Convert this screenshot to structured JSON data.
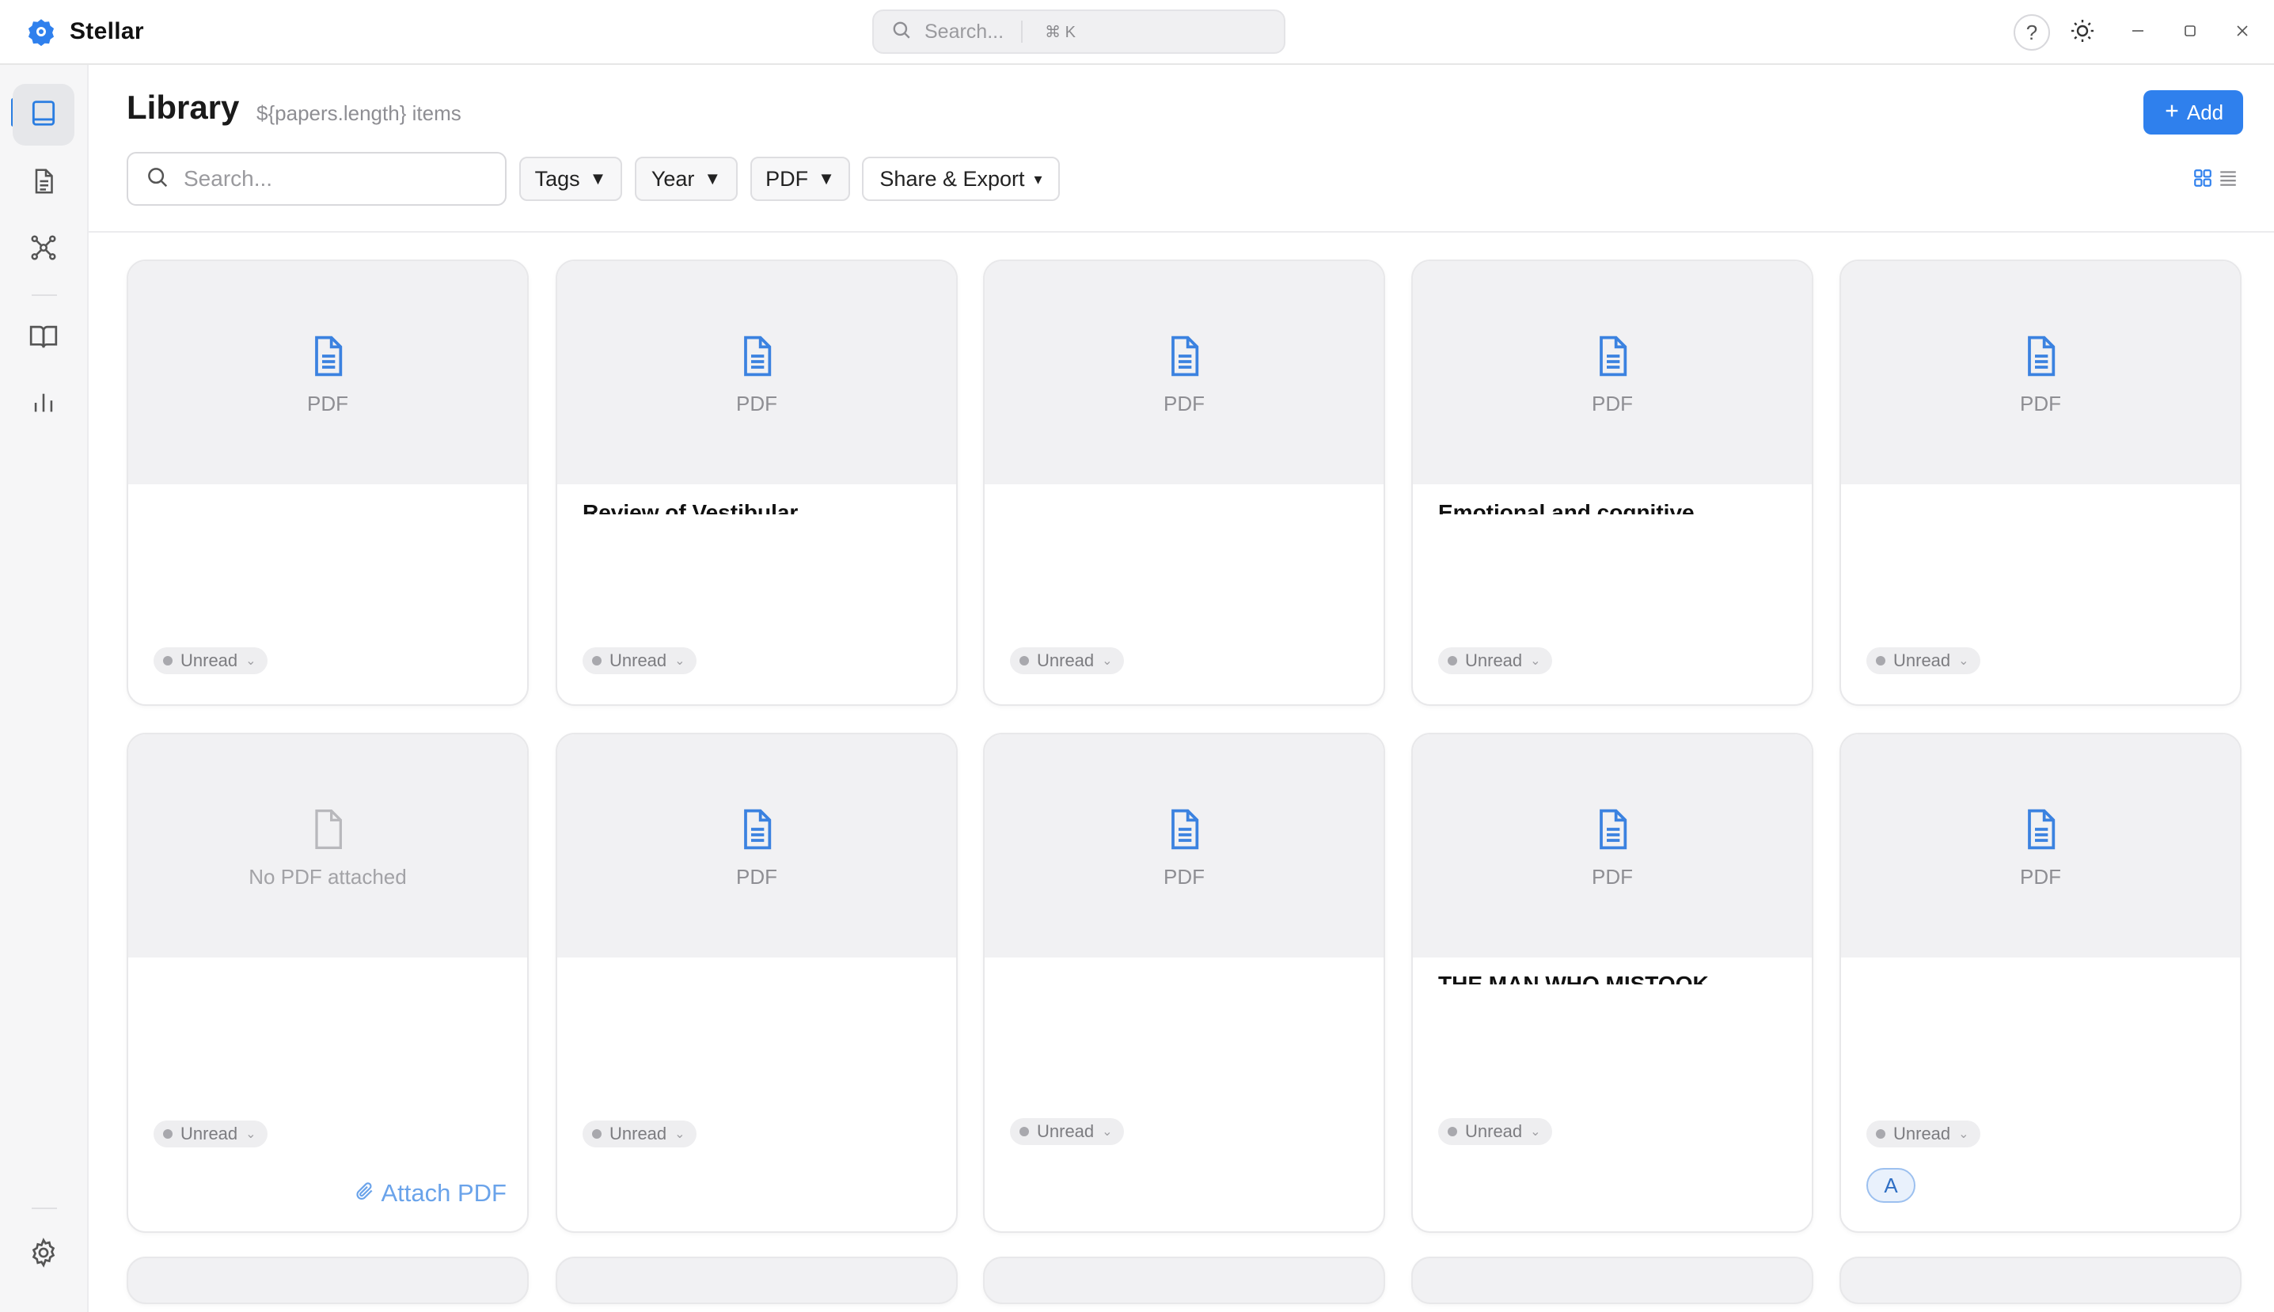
{
  "app": {
    "name": "Stellar"
  },
  "global_search": {
    "placeholder": "Search...",
    "shortcut": "⌘ K"
  },
  "titlebar": {
    "help_label": "?"
  },
  "sidebar": {
    "items": [
      {
        "name": "library",
        "icon": "library-icon",
        "active": true
      },
      {
        "name": "notes",
        "icon": "document-icon",
        "active": false
      },
      {
        "name": "graph",
        "icon": "graph-icon",
        "active": false
      },
      {
        "name": "reader",
        "icon": "book-open-icon",
        "active": false
      },
      {
        "name": "stats",
        "icon": "bar-chart-icon",
        "active": false
      }
    ],
    "settings_icon": "gear-icon"
  },
  "library": {
    "title": "Library",
    "subtitle": "${papers.length} items",
    "add_label": "Add",
    "search_placeholder": "Search...",
    "filters": [
      {
        "label": "Tags",
        "arrow": "▼"
      },
      {
        "label": "Year",
        "arrow": "▼"
      },
      {
        "label": "PDF",
        "arrow": "▼"
      },
      {
        "label": "Share & Export",
        "arrow": "▾"
      }
    ]
  },
  "cards": [
    {
      "thumb": "PDF",
      "status": "Unread"
    },
    {
      "thumb": "PDF",
      "status": "Unread",
      "title": "Review of Vestibular..."
    },
    {
      "thumb": "PDF",
      "status": "Unread"
    },
    {
      "thumb": "PDF",
      "status": "Unread",
      "title": "Emotional and cognitive..."
    },
    {
      "thumb": "PDF",
      "status": "Unread"
    },
    {
      "thumb": "No PDF attached",
      "status": "Unread",
      "attach_label": "Attach PDF"
    },
    {
      "thumb": "PDF",
      "status": "Unread"
    },
    {
      "thumb": "PDF",
      "status": "Unread"
    },
    {
      "thumb": "PDF",
      "status": "Unread",
      "title": "THE MAN WHO MISTOOK..."
    },
    {
      "thumb": "PDF",
      "status": "Unread",
      "avatar": "A"
    }
  ],
  "colors": {
    "accent": "#2f80ed",
    "pdf_icon": "#3b82e0",
    "muted": "#8e8e93"
  }
}
